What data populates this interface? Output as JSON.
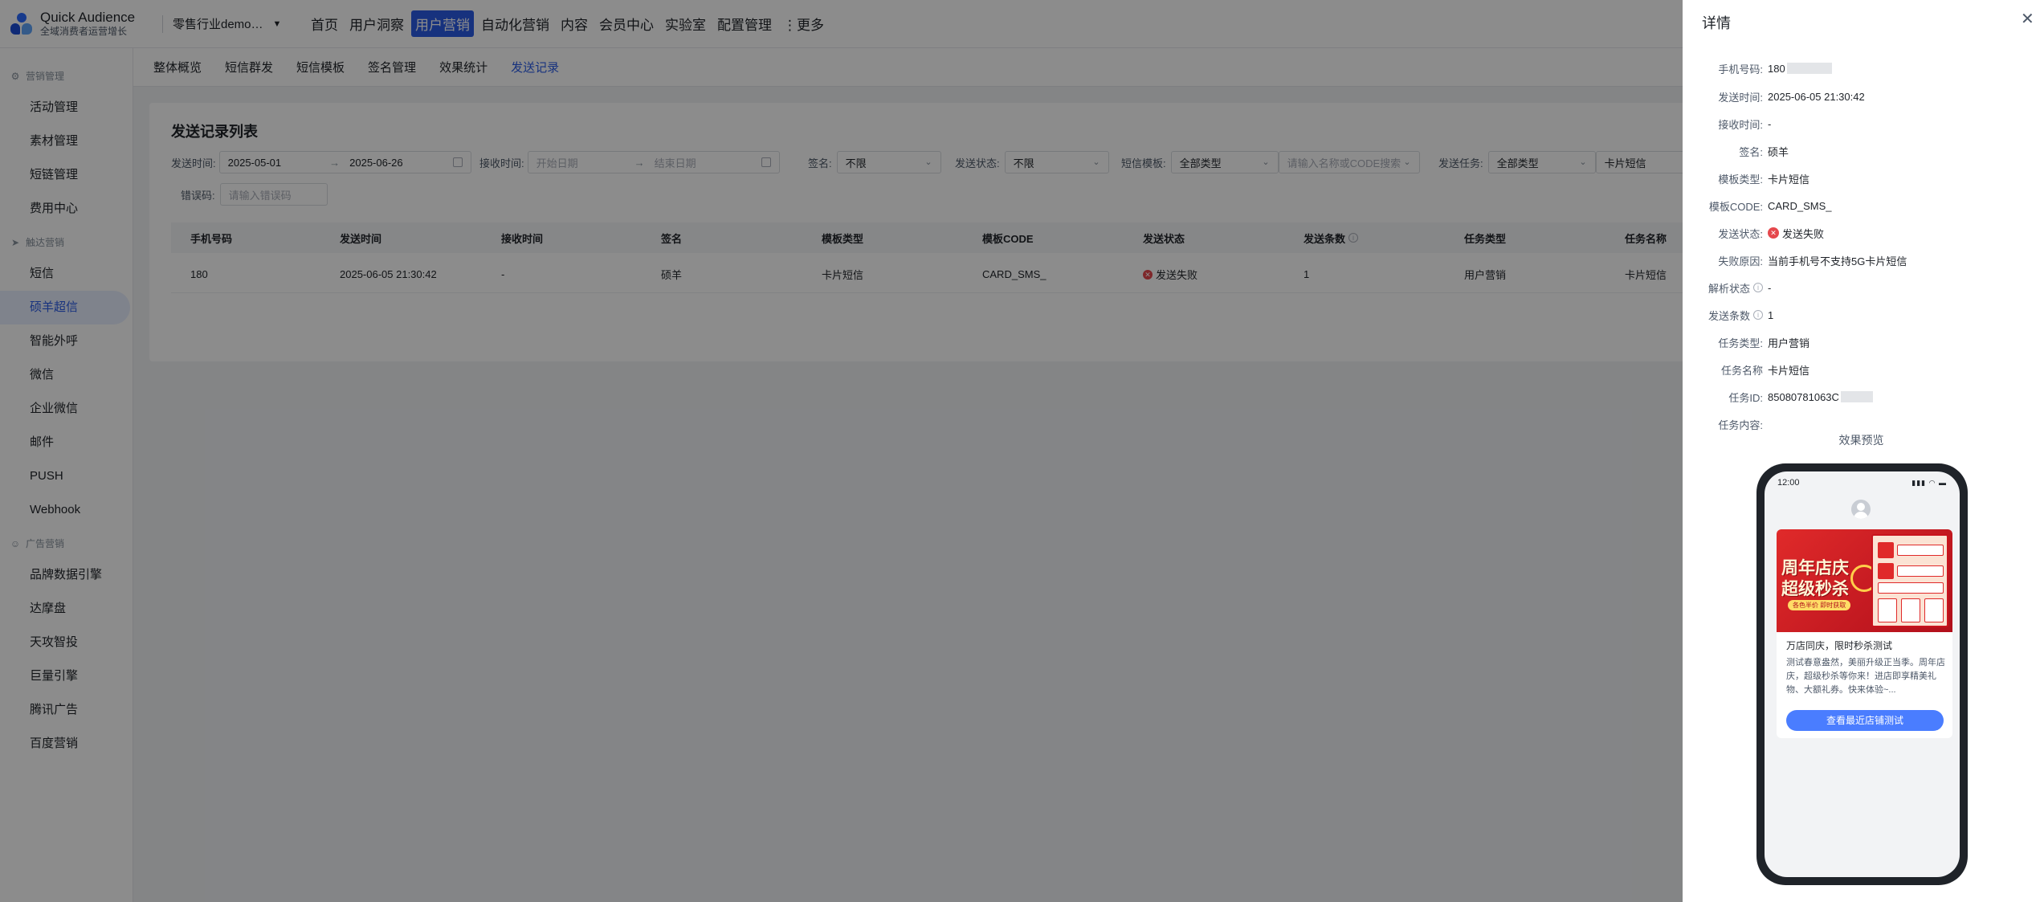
{
  "app": {
    "name": "Quick Audience",
    "tagline": "全域消费者运营增长",
    "tenant": "零售行业demo…"
  },
  "nav": [
    "首页",
    "用户洞察",
    "用户营销",
    "自动化营销",
    "内容",
    "会员中心",
    "实验室",
    "配置管理",
    "⋮更多"
  ],
  "nav_active": 2,
  "sidebar": {
    "groups": [
      {
        "title": "营销管理",
        "items": [
          "活动管理",
          "素材管理",
          "短链管理",
          "费用中心"
        ]
      },
      {
        "title": "触达营销",
        "items": [
          "短信",
          "硕羊超信",
          "智能外呼",
          "微信",
          "企业微信",
          "邮件",
          "PUSH",
          "Webhook"
        ]
      },
      {
        "title": "广告营销",
        "items": [
          "品牌数据引擎",
          "达摩盘",
          "天攻智投",
          "巨量引擎",
          "腾讯广告",
          "百度营销"
        ]
      }
    ],
    "active_item": "硕羊超信"
  },
  "subtabs": [
    "整体概览",
    "短信群发",
    "短信模板",
    "签名管理",
    "效果统计",
    "发送记录"
  ],
  "subtab_active": 5,
  "list": {
    "title": "发送记录列表",
    "filters": {
      "send_time_label": "发送时间:",
      "send_start": "2025-05-01",
      "send_end": "2025-06-26",
      "range_sep": "→",
      "recv_time_label": "接收时间:",
      "recv_start_ph": "开始日期",
      "recv_end_ph": "结束日期",
      "sign_label": "签名:",
      "sign_value": "不限",
      "status_label": "发送状态:",
      "status_value": "不限",
      "template_label": "短信模板:",
      "template_value": "全部类型",
      "template_search_ph": "请输入名称或CODE搜索",
      "task_label": "发送任务:",
      "task_value": "全部类型",
      "task_extra": "卡片短信",
      "error_label": "错误码:",
      "error_ph": "请输入错误码"
    },
    "columns": [
      "手机号码",
      "发送时间",
      "接收时间",
      "签名",
      "模板类型",
      "模板CODE",
      "发送状态",
      "发送条数",
      "任务类型",
      "任务名称"
    ],
    "rows": [
      {
        "phone": "180",
        "send_time": "2025-06-05 21:30:42",
        "recv_time": "-",
        "sign": "硕羊",
        "tpl_type": "卡片短信",
        "tpl_code": "CARD_SMS_",
        "status": "发送失败",
        "count": "1",
        "task_type": "用户营销",
        "task_name": "卡片短信"
      }
    ]
  },
  "drawer": {
    "title": "详情",
    "close": "✕",
    "fields": [
      {
        "label": "手机号码:",
        "value": "180",
        "blur": true
      },
      {
        "label": "发送时间:",
        "value": "2025-06-05 21:30:42"
      },
      {
        "label": "接收时间:",
        "value": "-"
      },
      {
        "label": "签名:",
        "value": "硕羊"
      },
      {
        "label": "模板类型:",
        "value": "卡片短信"
      },
      {
        "label": "模板CODE:",
        "value": "CARD_SMS_"
      },
      {
        "label": "发送状态:",
        "value": "发送失败",
        "status": "fail"
      },
      {
        "label": "失败原因:",
        "value": "当前手机号不支持5G卡片短信"
      },
      {
        "label": "解析状态",
        "value": "-",
        "info": true
      },
      {
        "label": "发送条数",
        "value": "1",
        "info": true
      },
      {
        "label": "任务类型:",
        "value": "用户营销"
      },
      {
        "label": "任务名称",
        "value": "卡片短信"
      },
      {
        "label": "任务ID:",
        "value": "85080781063C",
        "blur": true
      },
      {
        "label": "任务内容:",
        "value": ""
      }
    ],
    "preview_title": "效果预览",
    "phone": {
      "time": "12:00",
      "banner_line1": "周年店庆",
      "banner_line2": "超级秒杀",
      "banner_pill": "各色半价 即时获取",
      "card_title": "万店同庆，限时秒杀测试",
      "card_body": "测试春意盎然，美丽升级正当季。周年店庆，超级秒杀等你来！进店即享精美礼物、大额礼券。快来体验~...",
      "button": "查看最近店铺测试"
    }
  },
  "colors": {
    "accent": "#2b5ce6",
    "fail": "#e5484d",
    "button": "#4a7dff"
  }
}
